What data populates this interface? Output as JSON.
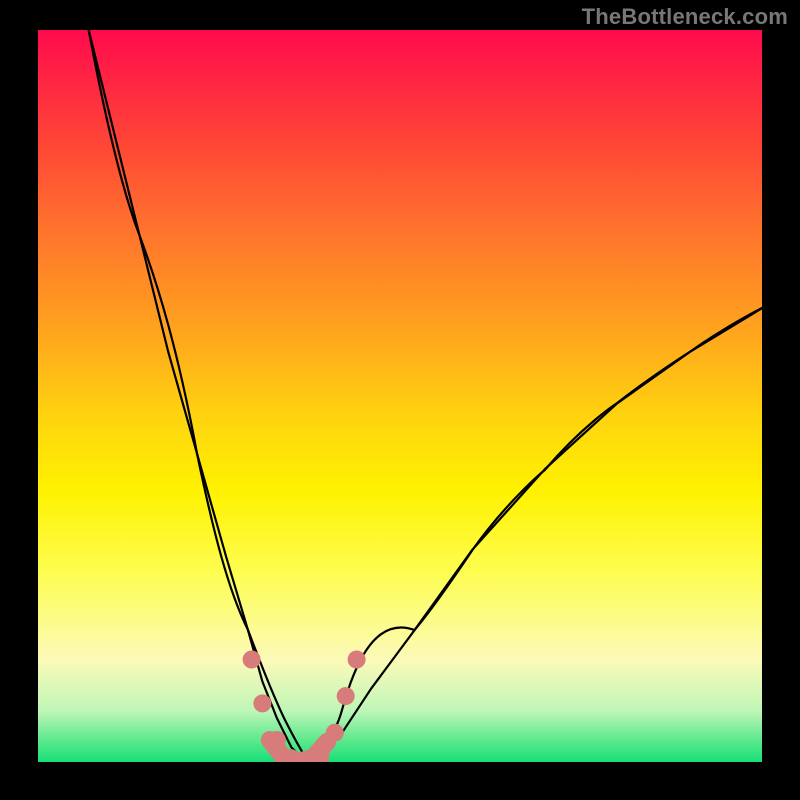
{
  "watermark": "TheBottleneck.com",
  "colors": {
    "background": "#000000",
    "watermark": "#777777",
    "curve": "#000000",
    "marker": "#d87b7b"
  },
  "chart_data": {
    "type": "line",
    "title": "",
    "xlabel": "",
    "ylabel": "",
    "xlim": [
      0,
      100
    ],
    "ylim": [
      0,
      100
    ],
    "grid": false,
    "series": [
      {
        "name": "bottleneck-curve",
        "x": [
          7,
          10,
          14,
          18,
          22,
          26,
          29,
          31,
          33,
          35,
          37,
          39,
          42,
          46,
          52,
          60,
          70,
          80,
          90,
          100
        ],
        "values": [
          100,
          88,
          72,
          56,
          42,
          28,
          18,
          11,
          6,
          2,
          0,
          1,
          4,
          10,
          18,
          29,
          40,
          49,
          56,
          62
        ]
      }
    ],
    "markers": {
      "name": "valley-dots",
      "x": [
        29.5,
        31,
        33,
        35,
        37,
        39,
        41,
        42.5,
        44
      ],
      "values": [
        14,
        8,
        3,
        0.5,
        0,
        0.8,
        4,
        9,
        14
      ]
    },
    "notes": "Axis ticks and labels are not rendered in the image; values are estimated from visual proportions of the curve against the plot area. y=0 at bottom, y=100 at top."
  }
}
